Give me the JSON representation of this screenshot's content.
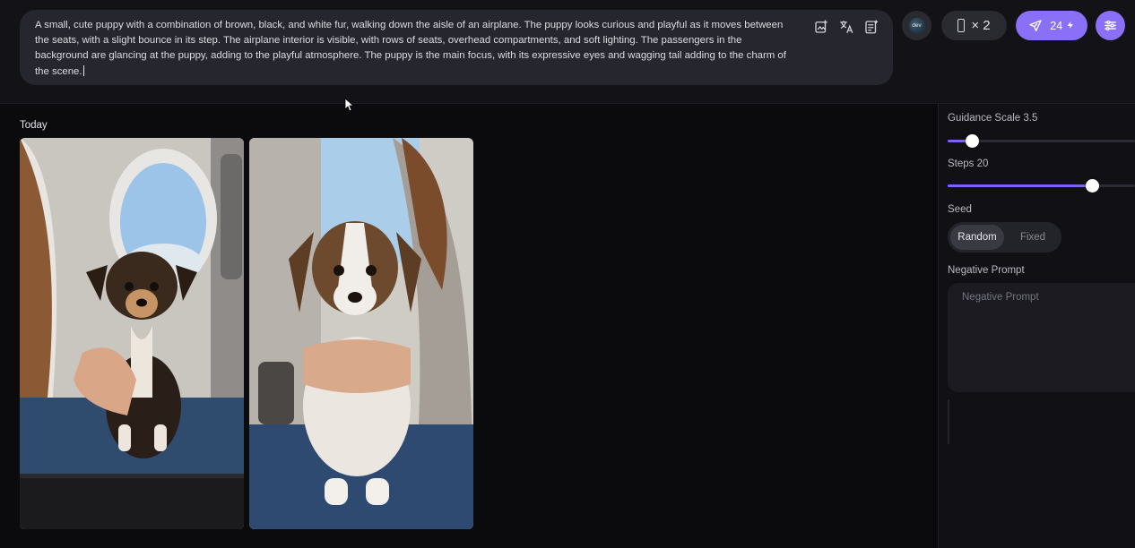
{
  "prompt": {
    "text": "A small, cute puppy with a combination of brown, black, and white fur, walking down the aisle of an airplane. The puppy looks curious and playful as it moves between the seats, with a slight bounce in its step. The airplane interior is visible, with rows of seats, overhead compartments, and soft lighting. The passengers in the background are glancing at the puppy, adding to the playful atmosphere. The puppy is the main focus, with its expressive eyes and wagging tail adding to the charm of the scene.",
    "tool_icons": [
      "image-prompt-icon",
      "translate-icon",
      "prompt-template-icon"
    ]
  },
  "toolbar": {
    "model_badge": "dev",
    "ratio_count": "× 2",
    "generate_credits": "24",
    "icons": [
      "phone-ratio-icon",
      "send-icon",
      "lightning-icon",
      "sliders-icon"
    ]
  },
  "gallery": {
    "section_label": "Today",
    "images": [
      {
        "name": "generated-image-1",
        "alt": "puppy-on-lap-window"
      },
      {
        "name": "generated-image-2",
        "alt": "puppy-held-in-seat"
      }
    ]
  },
  "settings": {
    "guidance": {
      "label": "Guidance Scale 3.5",
      "fraction": 0.13
    },
    "steps": {
      "label": "Steps 20",
      "fraction": 0.77
    },
    "seed": {
      "label": "Seed",
      "options": [
        "Random",
        "Fixed"
      ],
      "selected": "Random"
    },
    "negative_prompt": {
      "label": "Negative Prompt",
      "placeholder": "Negative Prompt"
    }
  },
  "colors": {
    "accent": "#8a70f7",
    "slider_fill": "#7d63ee",
    "background": "#0d0d10",
    "panel": "#111115"
  }
}
